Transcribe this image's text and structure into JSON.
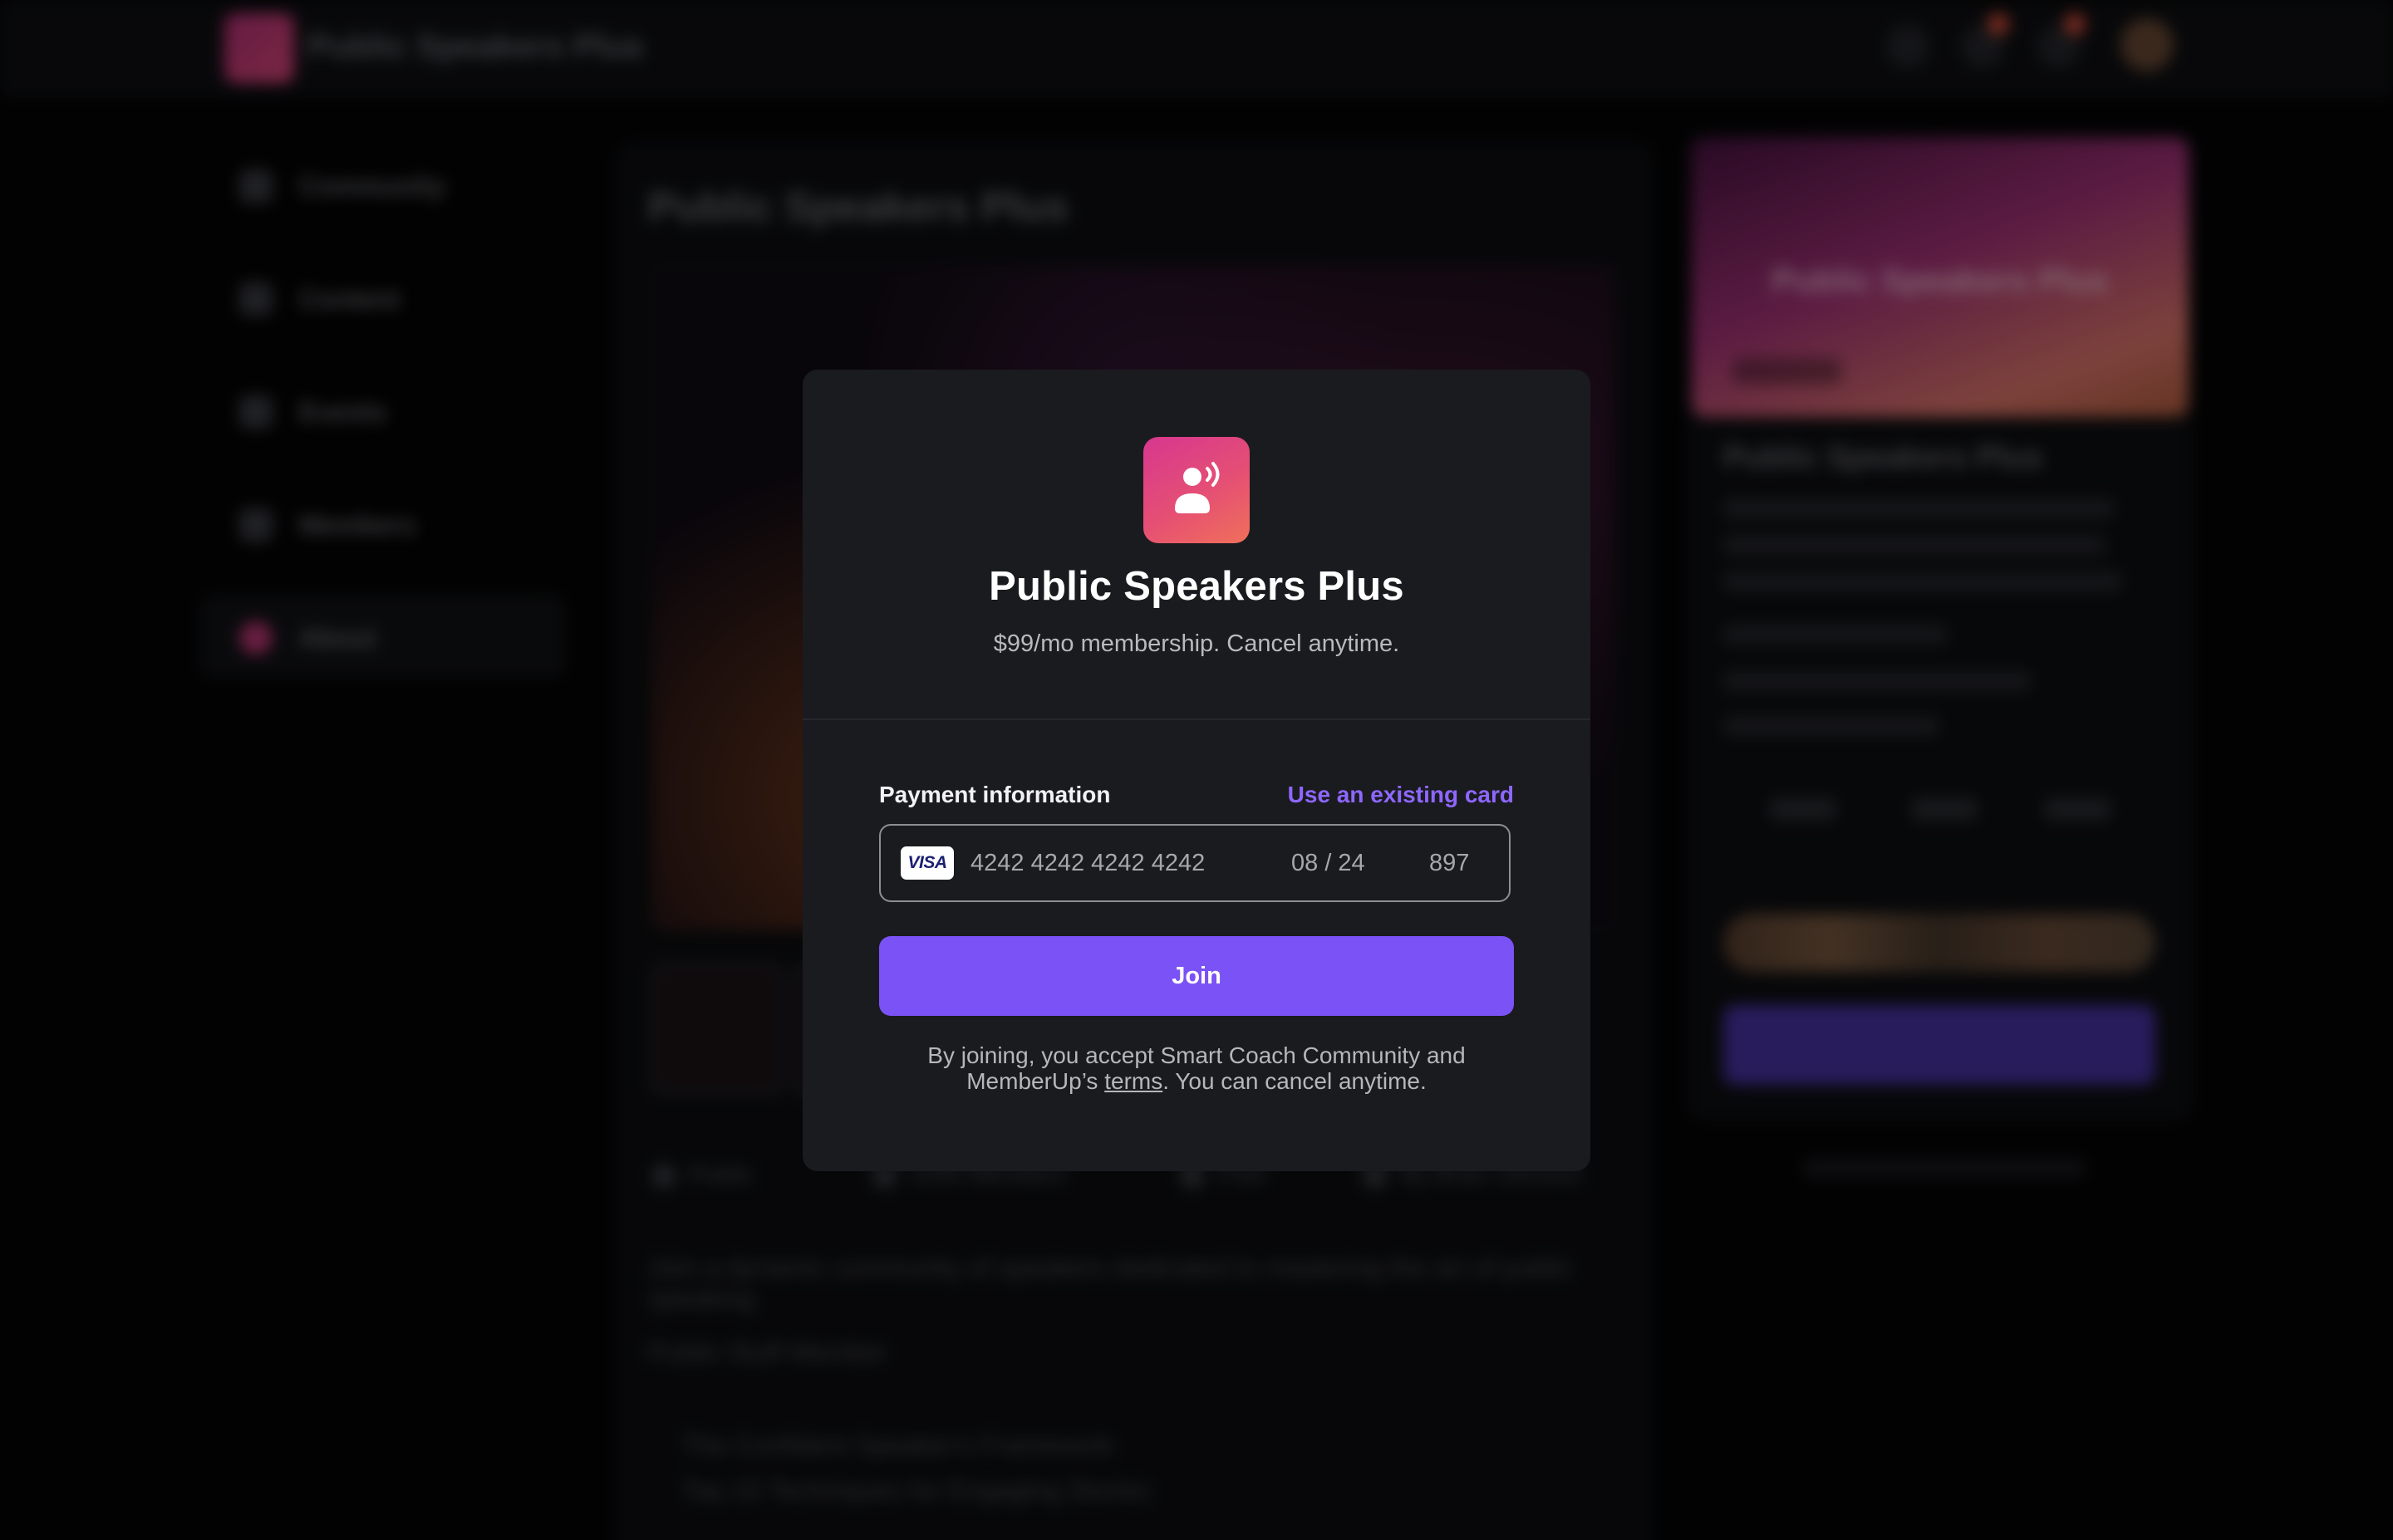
{
  "app": {
    "name": "Public Speakers Plus"
  },
  "background": {
    "sidebar": {
      "items": [
        {
          "label": "Community",
          "icon": "community-icon"
        },
        {
          "label": "Content",
          "icon": "content-icon"
        },
        {
          "label": "Events",
          "icon": "calendar-icon"
        },
        {
          "label": "Members",
          "icon": "members-icon"
        },
        {
          "label": "About",
          "icon": "info-icon",
          "active": true
        }
      ]
    },
    "main": {
      "title": "Public Speakers Plus",
      "meta": [
        "Public",
        "1040 Members",
        "Free",
        "By Brian Johnson"
      ],
      "description": [
        "Join a dynamic community of speakers dedicated to mastering the art of public speaking.",
        "Public Stuff Member"
      ],
      "list": [
        "The Confident Speaker's Framework",
        "Top 10 Techniques for Engaging Stories"
      ]
    },
    "right_card": {
      "banner_title": "Public Speakers Plus",
      "title": "Public Speakers Plus"
    }
  },
  "modal": {
    "title": "Public Speakers Plus",
    "subtitle": "$99/mo membership. Cancel anytime.",
    "payment_label": "Payment information",
    "existing_card_link": "Use an existing card",
    "card": {
      "brand": "VISA",
      "number": "4242 4242 4242 4242",
      "expiry": "08 / 24",
      "cvc": "897"
    },
    "join_label": "Join",
    "legal_prefix": "By joining, you accept Smart Coach Community and MemberUp’s ",
    "legal_link": "terms",
    "legal_suffix": ". You can cancel anytime."
  },
  "colors": {
    "accent": "#7b52f5",
    "link": "#8e67ff",
    "modal_bg": "#1a1b1f",
    "icon_gradient_start": "#d7378f",
    "icon_gradient_end": "#f0705a"
  }
}
